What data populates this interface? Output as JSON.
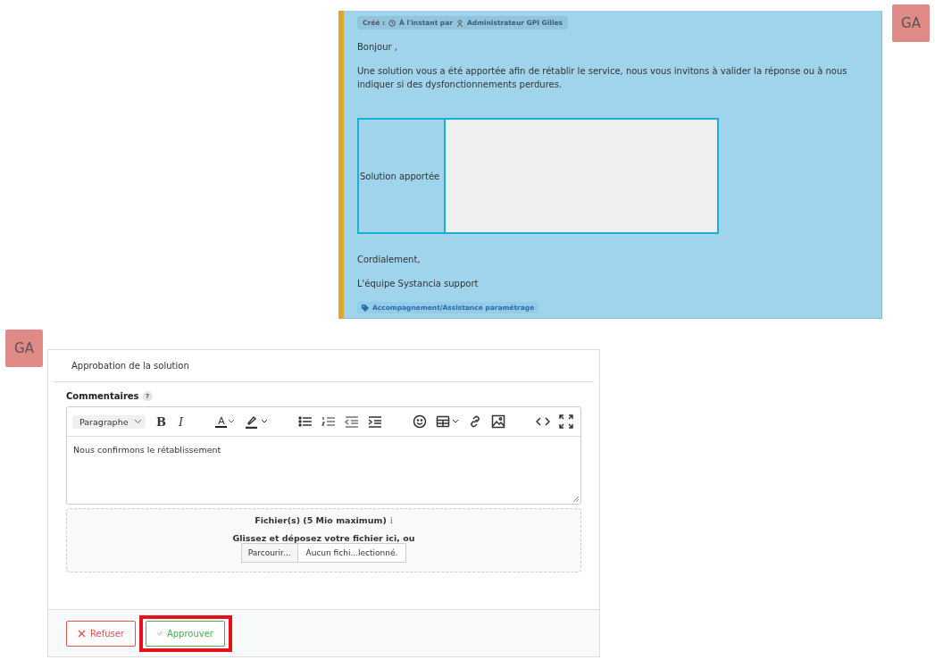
{
  "message": {
    "meta": {
      "created_label": "Créé :",
      "time": "À l'instant par",
      "author": "Administrateur GPI Gilles"
    },
    "avatar": "GA",
    "paragraphs": [
      "Bonjour ,",
      "Une solution vous a  été apportée afin de rétablir le service, nous vous invitons à valider la réponse ou à nous indiquer si des dysfonctionnements perdures."
    ],
    "table": {
      "label": "Solution apportée"
    },
    "closing": [
      "Cordialement,",
      "L'équipe Systancia support"
    ],
    "tag": "Accompagnement/Assistance paramétrage"
  },
  "form": {
    "avatar": "GA",
    "title": "Approbation de la solution",
    "comments_label": "Commentaires",
    "help": "?",
    "toolbar": [
      {
        "kind": "select",
        "label": "Paragraphe"
      },
      {
        "kind": "bold",
        "label": "B"
      },
      {
        "kind": "italic",
        "label": "I"
      },
      {
        "kind": "sep"
      },
      {
        "kind": "font-color",
        "label": "A"
      },
      {
        "kind": "highlight"
      },
      {
        "kind": "sep"
      },
      {
        "kind": "bullets"
      },
      {
        "kind": "numbers"
      },
      {
        "kind": "outdent"
      },
      {
        "kind": "indent"
      },
      {
        "kind": "sep"
      },
      {
        "kind": "emoji"
      },
      {
        "kind": "table"
      },
      {
        "kind": "link"
      },
      {
        "kind": "image"
      },
      {
        "kind": "sep"
      },
      {
        "kind": "code"
      },
      {
        "kind": "fullscreen"
      }
    ],
    "editor_text": "Nous confirmons le rétablissement",
    "files": {
      "title": "Fichier(s) (5 Mio maximum)",
      "info": "i",
      "drop": "Glissez et déposez votre fichier ici, ou",
      "browse": "Parcourir...",
      "none": "Aucun fichi...lectionné."
    },
    "buttons": [
      {
        "kind": "refuse",
        "label": "Refuser",
        "highlighted": false
      },
      {
        "kind": "approve",
        "label": "Approuver",
        "highlighted": true
      }
    ]
  }
}
